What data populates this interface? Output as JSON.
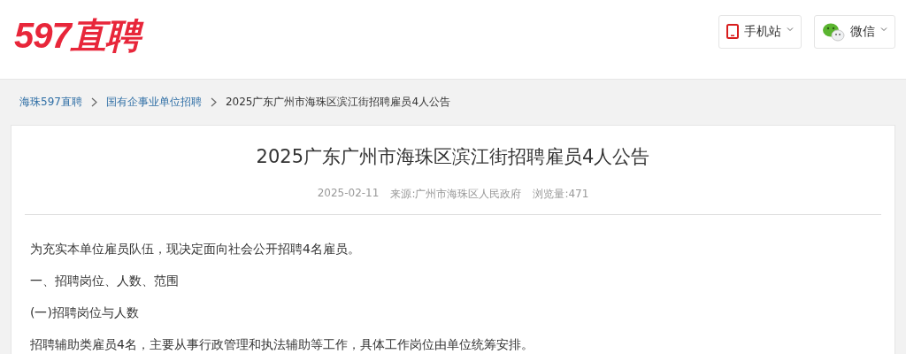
{
  "header": {
    "logo": "597直聘",
    "links": [
      {
        "kind": "mobile",
        "label": "手机站"
      },
      {
        "kind": "wechat",
        "label": "微信"
      }
    ]
  },
  "breadcrumb": [
    {
      "label": "海珠597直聘",
      "link": true
    },
    {
      "label": "国有企事业单位招聘",
      "link": true
    },
    {
      "label": "2025广东广州市海珠区滨江街招聘雇员4人公告",
      "link": false
    }
  ],
  "article": {
    "title": "2025广东广州市海珠区滨江街招聘雇员4人公告",
    "date": "2025-02-11",
    "source": "来源:广州市海珠区人民政府",
    "views": "浏览量:471",
    "paragraphs": [
      "为充实本单位雇员队伍，现决定面向社会公开招聘4名雇员。",
      "一、招聘岗位、人数、范围",
      "(一)招聘岗位与人数",
      "招聘辅助类雇员4名，主要从事行政管理和执法辅助等工作，具体工作岗位由单位统筹安排。"
    ]
  }
}
